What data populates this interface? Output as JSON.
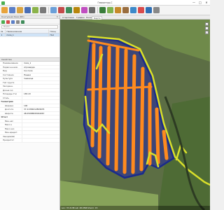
{
  "app": {
    "title": "Геоконтур-С",
    "brand_color": "#4caf50"
  },
  "window_controls": {
    "minimize": "—",
    "maximize": "□",
    "close": "✕"
  },
  "toolbar": {
    "buttons": [
      {
        "icon": "select-icon",
        "color": "#e8a33b"
      },
      {
        "icon": "layers-icon",
        "color": "#5b7fc7"
      },
      {
        "icon": "open-icon",
        "color": "#d9a441"
      },
      {
        "icon": "save-icon",
        "color": "#4a6fb5"
      },
      {
        "icon": "image-icon",
        "color": "#8bb34a"
      },
      {
        "icon": "gear-icon",
        "color": "#7a7a7a"
      },
      {
        "icon": "edit-icon",
        "color": "#6b9fd8"
      },
      {
        "icon": "chart-icon",
        "color": "#c44b4b"
      },
      {
        "icon": "table-icon",
        "color": "#3f8c5a"
      },
      {
        "icon": "ruler-icon",
        "color": "#b8860b"
      },
      {
        "icon": "filter-icon",
        "color": "#c04ec0"
      },
      {
        "icon": "grid-icon",
        "color": "#6c6c6c"
      },
      {
        "icon": "tractor-icon",
        "color": "#3a7d3a"
      },
      {
        "icon": "field-icon",
        "color": "#7fb24e"
      },
      {
        "icon": "export-icon",
        "color": "#c68a2a"
      },
      {
        "icon": "cube-icon",
        "color": "#9a6d3e"
      },
      {
        "icon": "globe-icon",
        "color": "#3c89c9"
      },
      {
        "icon": "pin-icon",
        "color": "#d94b4b"
      },
      {
        "icon": "compass-icon",
        "color": "#2f6fb5"
      },
      {
        "icon": "pencil-icon",
        "color": "#888888"
      }
    ]
  },
  "left_panel": {
    "header": "Контурная база (БК)",
    "search_placeholder": "Поиск",
    "columns": [
      "№",
      "Наименование",
      "Площ"
    ],
    "rows": [
      {
        "num": "1",
        "name": "поле_1",
        "area": "Пол"
      }
    ],
    "props_header": "Свойства",
    "properties": [
      {
        "type": "prop",
        "key": "Наименование",
        "value": "поле_1"
      },
      {
        "type": "prop",
        "key": "Первичн.наим.",
        "value": "Агроверде"
      },
      {
        "type": "prop",
        "key": "Вид",
        "value": "С/х поля"
      },
      {
        "type": "prop",
        "key": "Состояние",
        "value": "Пашня"
      },
      {
        "type": "prop",
        "key": "Культура",
        "value": "пшеница"
      },
      {
        "type": "prop",
        "key": "Тип грунта",
        "value": ""
      },
      {
        "type": "prop",
        "key": "Засоренн.",
        "value": ""
      },
      {
        "type": "prop",
        "key": "Длина (м)",
        "value": ""
      },
      {
        "type": "prop",
        "key": "Площадь (Га)",
        "value": "183.43"
      },
      {
        "type": "prop",
        "key": "Стиль",
        "value": ""
      },
      {
        "type": "group",
        "key": "Геометрия",
        "value": ""
      },
      {
        "type": "sub",
        "key": "Ширина",
        "value": "100"
      },
      {
        "type": "sub",
        "key": "Долгота",
        "value": "37.21384012809635"
      },
      {
        "type": "sub",
        "key": "Широта",
        "value": "48.05088845094067"
      },
      {
        "type": "group",
        "key": "Отчет",
        "value": ""
      },
      {
        "type": "sub",
        "key": "Мин.наг.",
        "value": ""
      },
      {
        "type": "sub",
        "key": "Макс.н",
        "value": ""
      },
      {
        "type": "sub",
        "key": "Макс.нес.",
        "value": ""
      },
      {
        "type": "sub",
        "key": "Мин.вредит.",
        "value": ""
      },
      {
        "type": "prop",
        "key": "Заездов(Ш)",
        "value": ""
      },
      {
        "type": "prop",
        "key": "Приоритет",
        "value": ""
      }
    ]
  },
  "tabs": [
    {
      "label": "Стартовая",
      "active": false
    },
    {
      "label": "График",
      "active": false
    },
    {
      "label": "Поля",
      "active": false
    },
    {
      "label": "Карта",
      "active": true
    }
  ],
  "map": {
    "boundary_color": "#1a2a8c",
    "track_color": "#ff8a1e",
    "road_color": "#d9df2a",
    "tools": [
      "+",
      "−",
      "⌖"
    ],
    "status": "Lon: 37.2138  Lat: 48.0508  Zoom: 15"
  }
}
